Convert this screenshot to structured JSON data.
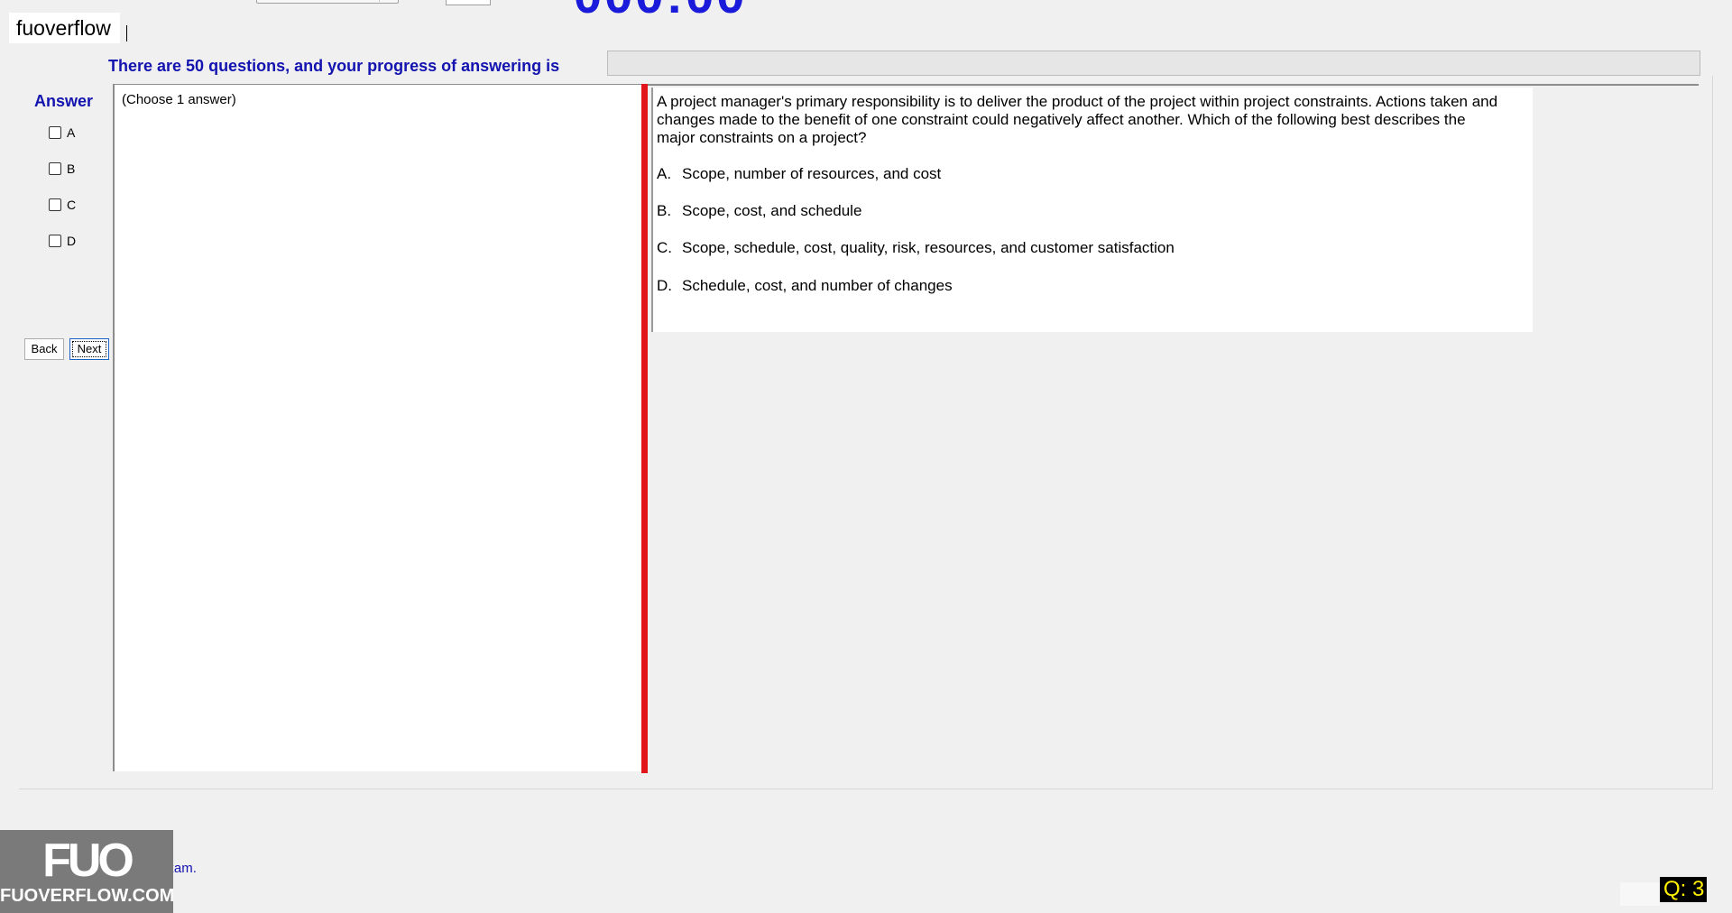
{
  "watermark": {
    "text": "fuoverflow"
  },
  "header": {
    "progress_label": "There are 50 questions, and your progress of answering is",
    "progress_fraction": 0
  },
  "answer_panel": {
    "title": "Answer",
    "options": [
      "A",
      "B",
      "C",
      "D"
    ],
    "back_label": "Back",
    "next_label": "Next"
  },
  "left_pane": {
    "instruction": "(Choose 1 answer)"
  },
  "question": {
    "text": "A project manager's primary responsibility is to deliver the product of the project within project constraints. Actions taken and changes made to the benefit of one constraint could negatively affect another. Which of the following best describes the major constraints on a project?",
    "choices": [
      {
        "letter": "A.",
        "text": "Scope, number of resources, and cost"
      },
      {
        "letter": "B.",
        "text": "Scope, cost, and schedule"
      },
      {
        "letter": "C.",
        "text": "Scope, schedule, cost, quality, risk, resources, and customer satisfaction"
      },
      {
        "letter": "D.",
        "text": "Schedule, cost, and number of changes"
      }
    ]
  },
  "footer": {
    "finish_label": "I want to finish the exam.",
    "logo_letters": "FUO",
    "logo_domain": "FUOVERFLOW.COM",
    "question_counter": "Q: 3"
  },
  "colors": {
    "accent_blue": "#1313b0",
    "splitter_red": "#e2151b",
    "counter_bg": "#000000",
    "counter_fg": "#ffef00"
  }
}
